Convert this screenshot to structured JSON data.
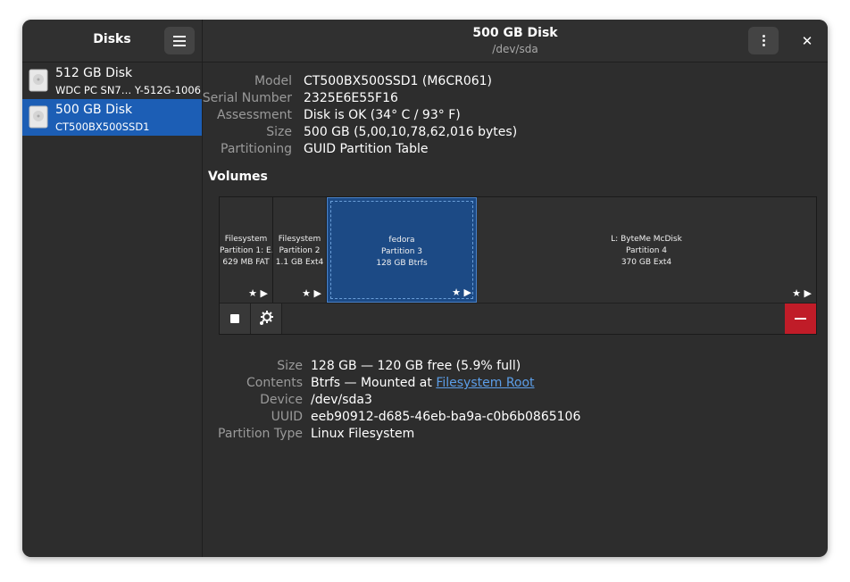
{
  "sidebar": {
    "title": "Disks",
    "disks": [
      {
        "name": "512 GB Disk",
        "subtitle": "WDC PC SN7… Y-512G-1006"
      },
      {
        "name": "500 GB Disk",
        "subtitle": "CT500BX500SSD1"
      }
    ]
  },
  "header": {
    "title": "500 GB Disk",
    "subtitle": "/dev/sda"
  },
  "disk_info": [
    {
      "label": "Model",
      "value": "CT500BX500SSD1 (M6CR061)"
    },
    {
      "label": "Serial Number",
      "value": "2325E6E55F16"
    },
    {
      "label": "Assessment",
      "value": "Disk is OK (34° C / 93° F)"
    },
    {
      "label": "Size",
      "value": "500 GB (5,00,10,78,62,016 bytes)"
    },
    {
      "label": "Partitioning",
      "value": "GUID Partition Table"
    }
  ],
  "volumes": {
    "title": "Volumes",
    "partitions": [
      {
        "line1": "Filesystem",
        "line2": "Partition 1: E…",
        "line3": "629 MB FAT"
      },
      {
        "line1": "Filesystem",
        "line2": "Partition 2",
        "line3": "1.1 GB Ext4"
      },
      {
        "line1": "fedora",
        "line2": "Partition 3",
        "line3": "128 GB Btrfs"
      },
      {
        "line1": "L: ByteMe McDisk",
        "line2": "Partition 4",
        "line3": "370 GB Ext4"
      }
    ]
  },
  "volume_info": {
    "size_label": "Size",
    "size_value": "128 GB — 120 GB free (5.9% full)",
    "contents_label": "Contents",
    "contents_prefix": "Btrfs — Mounted at ",
    "contents_link": "Filesystem Root",
    "device_label": "Device",
    "device_value": "/dev/sda3",
    "uuid_label": "UUID",
    "uuid_value": "eeb90912-d685-46eb-ba9a-c0b6b0865106",
    "type_label": "Partition Type",
    "type_value": "Linux Filesystem"
  },
  "colors": {
    "accent": "#1c5eb5",
    "destructive": "#c01c28",
    "link": "#5c9ee8"
  }
}
